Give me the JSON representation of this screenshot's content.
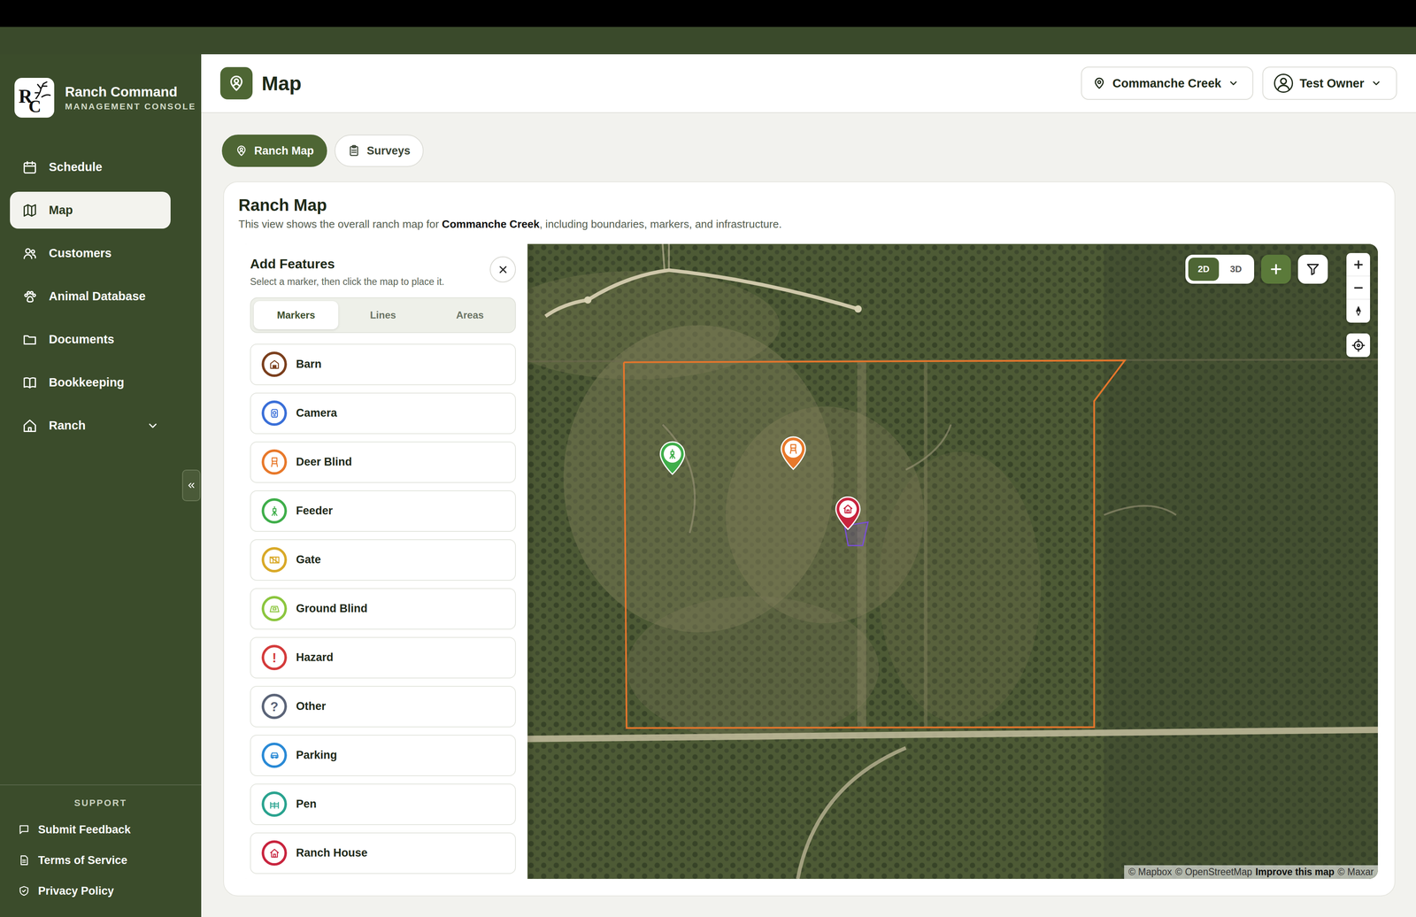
{
  "app": {
    "logo_letters": [
      "R",
      "C"
    ],
    "name": "Ranch Command",
    "subtitle": "MANAGEMENT CONSOLE"
  },
  "sidebar": {
    "items": [
      {
        "label": "Schedule",
        "selected": false,
        "kind": "link"
      },
      {
        "label": "Map",
        "selected": true,
        "kind": "link"
      },
      {
        "label": "Customers",
        "selected": false,
        "kind": "link"
      },
      {
        "label": "Animal Database",
        "selected": false,
        "kind": "link"
      },
      {
        "label": "Documents",
        "selected": false,
        "kind": "link"
      },
      {
        "label": "Bookkeeping",
        "selected": false,
        "kind": "link"
      },
      {
        "label": "Ranch",
        "selected": false,
        "kind": "group"
      }
    ],
    "support_heading": "SUPPORT",
    "support_items": [
      "Submit Feedback",
      "Terms of Service",
      "Privacy Policy"
    ]
  },
  "header": {
    "title": "Map",
    "ranch": "Commanche Creek",
    "user": "Test Owner"
  },
  "view_tabs": [
    {
      "label": "Ranch Map",
      "selected": true
    },
    {
      "label": "Surveys",
      "selected": false
    }
  ],
  "card": {
    "title": "Ranch Map",
    "description_before": "This view shows the overall ranch map for",
    "description_bold": "Commanche Creek",
    "description_after": ", including boundaries, markers, and infrastructure."
  },
  "panel": {
    "title": "Add Features",
    "hint": "Select a marker, then click the map to place it.",
    "tabs": [
      {
        "label": "Markers",
        "selected": true
      },
      {
        "label": "Lines",
        "selected": false
      },
      {
        "label": "Areas",
        "selected": false
      }
    ],
    "markers": [
      {
        "label": "Barn",
        "color": "#7b3f1d"
      },
      {
        "label": "Camera",
        "color": "#3a6fd8"
      },
      {
        "label": "Deer Blind",
        "color": "#e8792b"
      },
      {
        "label": "Feeder",
        "color": "#3fae4a"
      },
      {
        "label": "Gate",
        "color": "#d9a928"
      },
      {
        "label": "Ground Blind",
        "color": "#8cc63f"
      },
      {
        "label": "Hazard",
        "color": "#d43b3b",
        "glyph": "!"
      },
      {
        "label": "Other",
        "color": "#5b6478",
        "glyph": "?"
      },
      {
        "label": "Parking",
        "color": "#2a8ad6"
      },
      {
        "label": "Pen",
        "color": "#2aa38f"
      },
      {
        "label": "Ranch House",
        "color": "#c8243e"
      }
    ]
  },
  "map": {
    "modes": [
      {
        "label": "2D",
        "selected": true
      },
      {
        "label": "3D",
        "selected": false
      }
    ],
    "pins": [
      {
        "kind": "feeder",
        "color": "#3fae4a"
      },
      {
        "kind": "deer-blind",
        "color": "#e8792b"
      },
      {
        "kind": "ranch-house",
        "color": "#c8243e"
      }
    ],
    "attribution": [
      {
        "text": "© Mapbox",
        "bold": false
      },
      {
        "text": "© OpenStreetMap",
        "bold": false
      },
      {
        "text": "Improve this map",
        "bold": true
      },
      {
        "text": "© Maxar",
        "bold": false
      }
    ]
  }
}
